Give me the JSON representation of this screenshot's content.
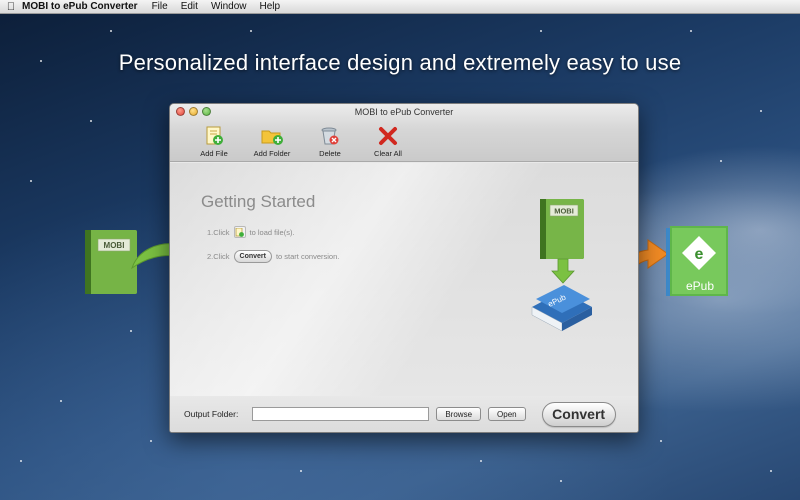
{
  "menubar": {
    "app_name": "MOBI to ePub Converter",
    "items": [
      "File",
      "Edit",
      "Window",
      "Help"
    ]
  },
  "tagline": "Personalized interface design and extremely easy to use",
  "window": {
    "title": "MOBI to ePub Converter",
    "toolbar": {
      "add_file": "Add File",
      "add_folder": "Add Folder",
      "delete": "Delete",
      "clear_all": "Clear All"
    },
    "content": {
      "heading": "Getting Started",
      "step1_prefix": "1.Click",
      "step1_suffix": "to load file(s).",
      "step2_prefix": "2.Click",
      "step2_button": "Convert",
      "step2_suffix": "to start conversion."
    },
    "footer": {
      "output_label": "Output Folder:",
      "output_value": "",
      "browse": "Browse",
      "open": "Open",
      "convert": "Convert"
    }
  },
  "graphics": {
    "mobi_label": "MOBI",
    "epub_label": "ePub",
    "epub_badge": "ePub",
    "epub_logo_letter": "e"
  },
  "colors": {
    "book_green": "#6fae3f",
    "book_blue": "#3b7fcf",
    "arrow_green": "#7bc142",
    "arrow_orange": "#f08a24"
  }
}
